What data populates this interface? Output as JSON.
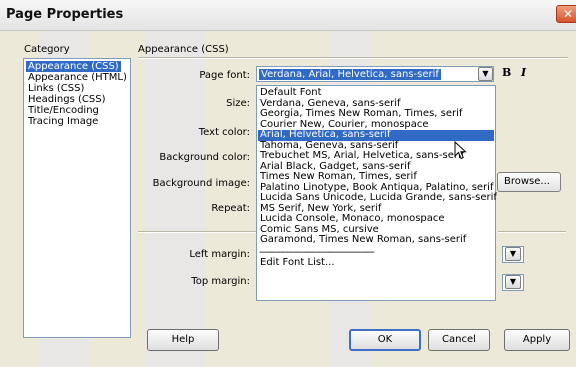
{
  "window": {
    "title": "Page Properties",
    "close_glyph": "✕"
  },
  "category": {
    "label": "Category",
    "items": [
      "Appearance (CSS)",
      "Appearance (HTML)",
      "Links (CSS)",
      "Headings (CSS)",
      "Title/Encoding",
      "Tracing Image"
    ],
    "selected_index": 0
  },
  "panel": {
    "section_title": "Appearance (CSS)",
    "page_font_label": "Page font:",
    "page_font_value": "Verdana, Arial, Helvetica, sans-serif",
    "size_label": "Size:",
    "text_color_label": "Text color:",
    "background_color_label": "Background color:",
    "background_image_label": "Background image:",
    "browse_button": "Browse...",
    "repeat_label": "Repeat:",
    "left_margin_label": "Left margin:",
    "top_margin_label": "Top margin:",
    "bold_label": "B",
    "italic_label": "I"
  },
  "font_dropdown": {
    "items": [
      "Default Font",
      "Verdana, Geneva, sans-serif",
      "Georgia, Times New Roman, Times, serif",
      "Courier New, Courier, monospace",
      "Arial, Helvetica, sans-serif",
      "Tahoma, Geneva, sans-serif",
      "Trebuchet MS, Arial, Helvetica, sans-serif",
      "Arial Black, Gadget, sans-serif",
      "Times New Roman, Times, serif",
      "Palatino Linotype, Book Antiqua, Palatino, serif",
      "Lucida Sans Unicode, Lucida Grande, sans-serif",
      "MS Serif, New York, serif",
      "Lucida Console, Monaco, monospace",
      "Comic Sans MS, cursive",
      "Garamond, Times New Roman, sans-serif"
    ],
    "highlighted_index": 4,
    "separator": "--------------------------------------------",
    "edit_item": "Edit Font List..."
  },
  "buttons": {
    "help": "Help",
    "ok": "OK",
    "cancel": "Cancel",
    "apply": "Apply"
  },
  "icons": {
    "dropdown_arrow": "▼"
  },
  "colors": {
    "selection": "#316ac5",
    "dialog_bg": "#ece9d8",
    "close": "#d4532b"
  }
}
